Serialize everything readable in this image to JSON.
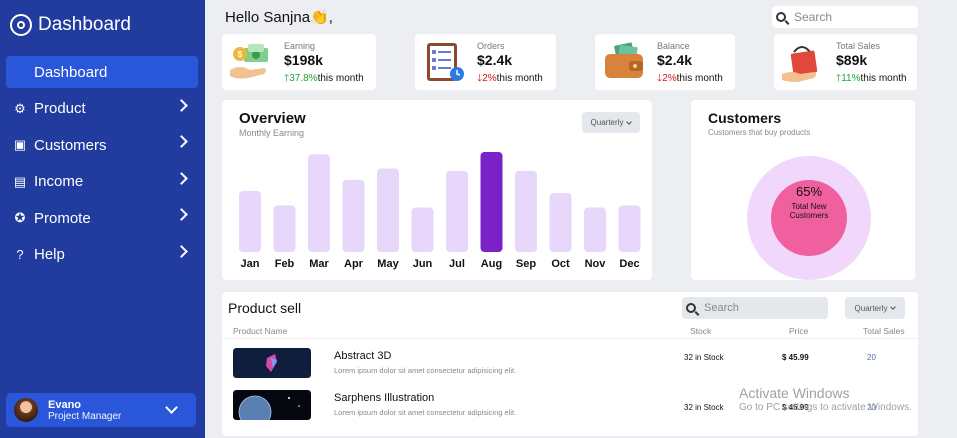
{
  "sidebar": {
    "brand": "Dashboard",
    "items": [
      {
        "label": "Dashboard",
        "icon": "dashboard-icon"
      },
      {
        "label": "Product",
        "icon": "gear-icon"
      },
      {
        "label": "Customers",
        "icon": "user-icon"
      },
      {
        "label": "Income",
        "icon": "wallet-icon"
      },
      {
        "label": "Promote",
        "icon": "star-icon"
      },
      {
        "label": "Help",
        "icon": "help-icon"
      }
    ],
    "user": {
      "name": "Evano",
      "role": "Project Manager"
    }
  },
  "header": {
    "greeting": "Hello Sanjna👏,",
    "search_placeholder": "Search"
  },
  "stats": [
    {
      "label": "Earning",
      "value": "$198k",
      "change": "37.8%",
      "trend": "up",
      "suffix": "this month"
    },
    {
      "label": "Orders",
      "value": "$2.4k",
      "change": "2%",
      "trend": "down",
      "suffix": "this month"
    },
    {
      "label": "Balance",
      "value": "$2.4k",
      "change": "2%",
      "trend": "down",
      "suffix": "this month"
    },
    {
      "label": "Total Sales",
      "value": "$89k",
      "change": "11%",
      "trend": "up",
      "suffix": "this month"
    }
  ],
  "overview": {
    "title": "Overview",
    "subtitle": "Monthly Earning",
    "period": "Quarterly",
    "chart_data": {
      "type": "bar",
      "categories": [
        "Jan",
        "Feb",
        "Mar",
        "Apr",
        "May",
        "Jun",
        "Jul",
        "Aug",
        "Sep",
        "Oct",
        "Nov",
        "Dec"
      ],
      "values": [
        55,
        42,
        88,
        65,
        75,
        40,
        73,
        90,
        73,
        53,
        40,
        42
      ],
      "highlight": "Aug",
      "title": "",
      "xlabel": "",
      "ylabel": "",
      "grid": false,
      "colors": {
        "bar": "#e6d7fb",
        "highlight": "#7a22c8"
      }
    }
  },
  "customers": {
    "title": "Customers",
    "subtitle": "Customers that buy products",
    "percent": "65%",
    "caption_line1": "Total New",
    "caption_line2": "Customers"
  },
  "products": {
    "title": "Product sell",
    "search_placeholder": "Search",
    "period": "Quarterly",
    "headers": {
      "name": "Product Name",
      "stock": "Stock",
      "price": "Price",
      "sales": "Total Sales"
    },
    "rows": [
      {
        "name": "Abstract 3D",
        "desc": "Lorem ipsum dolor sit amet consectetur adipisicing elit.",
        "stock": "32 in Stock",
        "price": "$ 45.99",
        "sales": "20"
      },
      {
        "name": "Sarphens Illustration",
        "desc": "Lorem ipsum dolor sit amet consectetur adipisicing elit.",
        "stock": "32 in Stock",
        "price": "$ 45.99",
        "sales": "20"
      }
    ]
  },
  "watermark": {
    "line1": "Activate Windows",
    "line2": "Go to PC settings to activate Windows."
  },
  "colors": {
    "sidebar": "#213c9e",
    "active": "#2a56d9",
    "accent": "#7a22c8",
    "donut_outer": "#f0d7fb",
    "donut_inner": "#f0609e"
  }
}
